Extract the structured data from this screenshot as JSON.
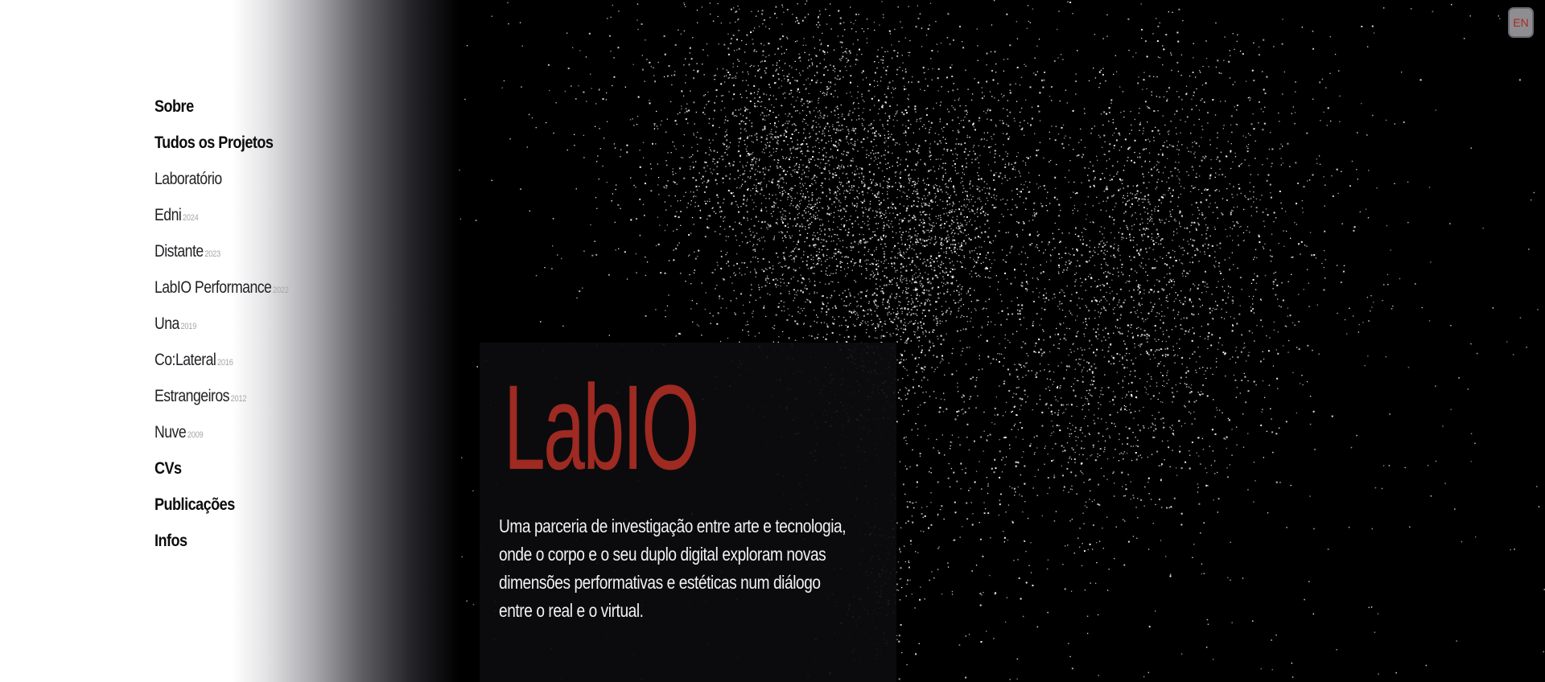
{
  "nav": {
    "items": [
      {
        "label": "Sobre",
        "year": "",
        "type": "main"
      },
      {
        "label": "Tudos os Projetos",
        "year": "",
        "type": "main"
      },
      {
        "label": "Laboratório",
        "year": "",
        "type": "sub"
      },
      {
        "label": "Edni",
        "year": "2024",
        "type": "sub"
      },
      {
        "label": "Distante",
        "year": "2023",
        "type": "sub"
      },
      {
        "label": "LabIO Performance",
        "year": "2022",
        "type": "sub"
      },
      {
        "label": "Una",
        "year": "2019",
        "type": "sub"
      },
      {
        "label": "Co:Lateral",
        "year": "2016",
        "type": "sub"
      },
      {
        "label": "Estrangeiros",
        "year": "2012",
        "type": "sub"
      },
      {
        "label": "Nuve",
        "year": "2009",
        "type": "sub"
      },
      {
        "label": "CVs",
        "year": "",
        "type": "main"
      },
      {
        "label": "Publicações",
        "year": "",
        "type": "main"
      },
      {
        "label": "Infos",
        "year": "",
        "type": "main"
      }
    ]
  },
  "hero": {
    "title": "LabIO",
    "description_lines": [
      "Uma parceria de investigação entre arte e tecnologia,",
      "onde o corpo e o seu duplo digital exploram novas",
      "dimensões performativas e estéticas num diálogo",
      "entre o real e o virtual."
    ]
  },
  "language_button": {
    "label": "EN"
  },
  "colors": {
    "accent": "#9e2a22",
    "background": "#000000",
    "panel": "#ffffff",
    "particle": "#ffffff"
  },
  "icons": []
}
